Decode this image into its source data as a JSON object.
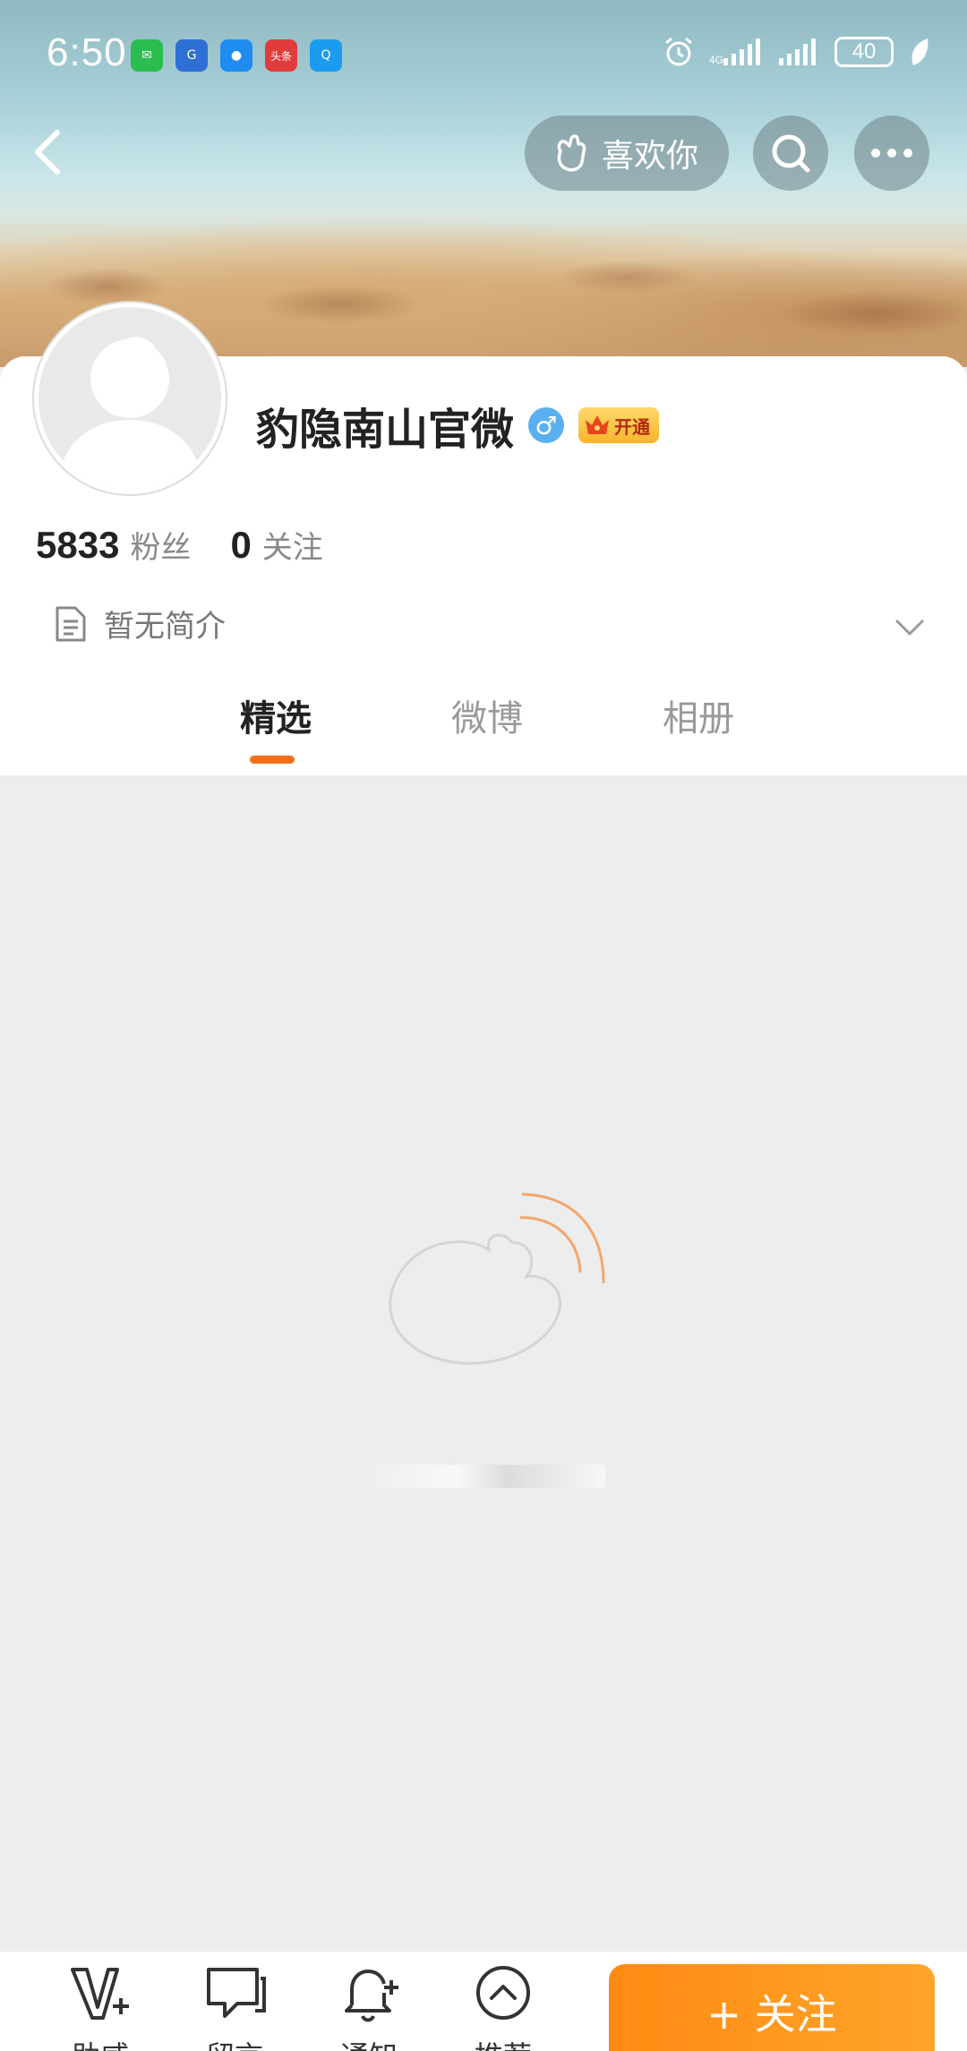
{
  "status_bar": {
    "time": "6:50",
    "battery": "40",
    "app_icons": [
      {
        "name": "wechat-icon",
        "color": "#2bbd4f",
        "glyph": "✉"
      },
      {
        "name": "app-ez-icon",
        "color": "#2e6fd6",
        "glyph": "G"
      },
      {
        "name": "message-icon",
        "color": "#1e8cf0",
        "glyph": "●"
      },
      {
        "name": "toutiao-icon",
        "color": "#e23b3b",
        "glyph": "头条"
      },
      {
        "name": "search-app-icon",
        "color": "#1b9bf0",
        "glyph": "Q"
      }
    ]
  },
  "header": {
    "like_label": "喜欢你"
  },
  "profile": {
    "nickname": "豹隐南山官微",
    "gender_symbol": "♂",
    "vip_label": "开通",
    "followers_count": "5833",
    "followers_label": "粉丝",
    "following_count": "0",
    "following_label": "关注",
    "bio": "暂无简介"
  },
  "tabs": [
    {
      "label": "精选",
      "active": true
    },
    {
      "label": "微博",
      "active": false
    },
    {
      "label": "相册",
      "active": false
    }
  ],
  "bottom_bar": {
    "items": [
      {
        "label": "助威",
        "icon": "cheer-icon"
      },
      {
        "label": "留言",
        "icon": "comment-icon"
      },
      {
        "label": "通知",
        "icon": "notify-bell-icon"
      },
      {
        "label": "推荐",
        "icon": "recommend-icon"
      }
    ],
    "follow_label": "+ 关注"
  },
  "colors": {
    "accent": "#f46f1b",
    "follow_button": "#ff8a12",
    "loading_placeholder": "#ededed"
  }
}
